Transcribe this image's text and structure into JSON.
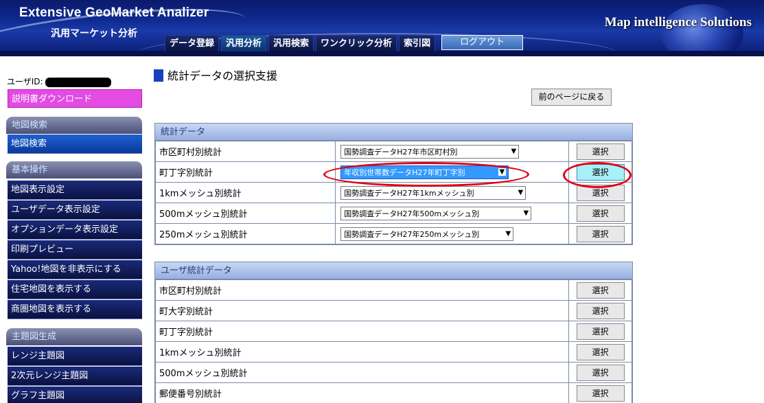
{
  "header": {
    "title": "Extensive GeoMarket Analizer",
    "subtitle": "汎用マーケット分析",
    "brand": "Map intelligence Solutions",
    "tabs": [
      {
        "label": "データ登録"
      },
      {
        "label": "汎用分析"
      },
      {
        "label": "汎用検索"
      },
      {
        "label": "ワンクリック分析"
      },
      {
        "label": "索引図"
      }
    ],
    "logout_label": "ログアウト"
  },
  "sidebar": {
    "user_id_label": "ユーザID:",
    "download_label": "説明書ダウンロード",
    "sections": [
      {
        "title": "地図検索",
        "items": [
          "地図検索"
        ]
      },
      {
        "title": "基本操作",
        "items": [
          "地図表示設定",
          "ユーザデータ表示設定",
          "オプションデータ表示設定",
          "印刷プレビュー",
          "Yahoo!地図を非表示にする",
          "住宅地図を表示する",
          "商圏地図を表示する"
        ]
      },
      {
        "title": "主題図生成",
        "items": [
          "レンジ主題図",
          "2次元レンジ主題図",
          "グラフ主題図"
        ]
      }
    ]
  },
  "main": {
    "page_title": "統計データの選択支援",
    "back_button": "前のページに戻る",
    "stats_panel": {
      "title": "統計データ",
      "rows": [
        {
          "label": "市区町村別統計",
          "select": "国勢調査データH27年市区町村別"
        },
        {
          "label": "町丁字別統計",
          "select": "年収別世帯数データH27年町丁字別"
        },
        {
          "label": "1kmメッシュ別統計",
          "select": "国勢調査データH27年1kmメッシュ別"
        },
        {
          "label": "500mメッシュ別統計",
          "select": "国勢調査データH27年500mメッシュ別"
        },
        {
          "label": "250mメッシュ別統計",
          "select": "国勢調査データH27年250mメッシュ別"
        }
      ],
      "button_label": "選択"
    },
    "user_panel": {
      "title": "ユーザ統計データ",
      "rows": [
        {
          "label": "市区町村別統計"
        },
        {
          "label": "町大字別統計"
        },
        {
          "label": "町丁字別統計"
        },
        {
          "label": "1kmメッシュ別統計"
        },
        {
          "label": "500mメッシュ別統計"
        },
        {
          "label": "郵便番号別統計"
        }
      ],
      "button_label": "選択"
    }
  }
}
